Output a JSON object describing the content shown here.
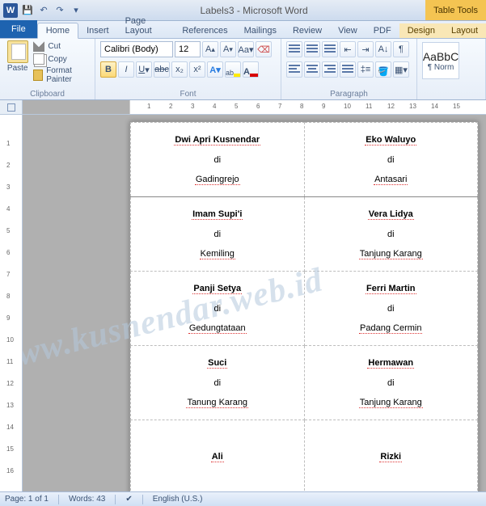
{
  "title": "Labels3 - Microsoft Word",
  "tableTools": "Table Tools",
  "tabs": {
    "file": "File",
    "home": "Home",
    "insert": "Insert",
    "pagelayout": "Page Layout",
    "references": "References",
    "mailings": "Mailings",
    "review": "Review",
    "view": "View",
    "pdf": "PDF",
    "design": "Design",
    "layout": "Layout"
  },
  "clipboard": {
    "paste": "Paste",
    "cut": "Cut",
    "copy": "Copy",
    "formatPainter": "Format Painter",
    "label": "Clipboard"
  },
  "font": {
    "name": "Calibri (Body)",
    "size": "12",
    "label": "Font"
  },
  "paragraph": {
    "label": "Paragraph"
  },
  "styles": {
    "sample": "AaBbC",
    "name": "¶ Norm"
  },
  "status": {
    "page": "Page: 1 of 1",
    "words": "Words: 43",
    "lang": "English (U.S.)"
  },
  "watermark": "www.kusnendar.web.id",
  "labels": [
    {
      "left": {
        "name": "Dwi Apri Kusnendar",
        "di": "di",
        "place": "Gadingrejo"
      },
      "right": {
        "name": "Eko Waluyo",
        "di": "di",
        "place": "Antasari"
      }
    },
    {
      "left": {
        "name": "Imam Supi'i",
        "di": "di",
        "place": "Kemiling"
      },
      "right": {
        "name": "Vera Lidya",
        "di": "di",
        "place": "Tanjung Karang"
      }
    },
    {
      "left": {
        "name": "Panji Setya",
        "di": "di",
        "place": "Gedungtataan"
      },
      "right": {
        "name": "Ferri Martin",
        "di": "di",
        "place": "Padang Cermin"
      }
    },
    {
      "left": {
        "name": "Suci",
        "di": "di",
        "place": "Tanung Karang"
      },
      "right": {
        "name": "Hermawan",
        "di": "di",
        "place": "Tanjung Karang"
      }
    },
    {
      "left": {
        "name": "Ali",
        "di": "",
        "place": ""
      },
      "right": {
        "name": "Rizki",
        "di": "",
        "place": ""
      }
    }
  ]
}
